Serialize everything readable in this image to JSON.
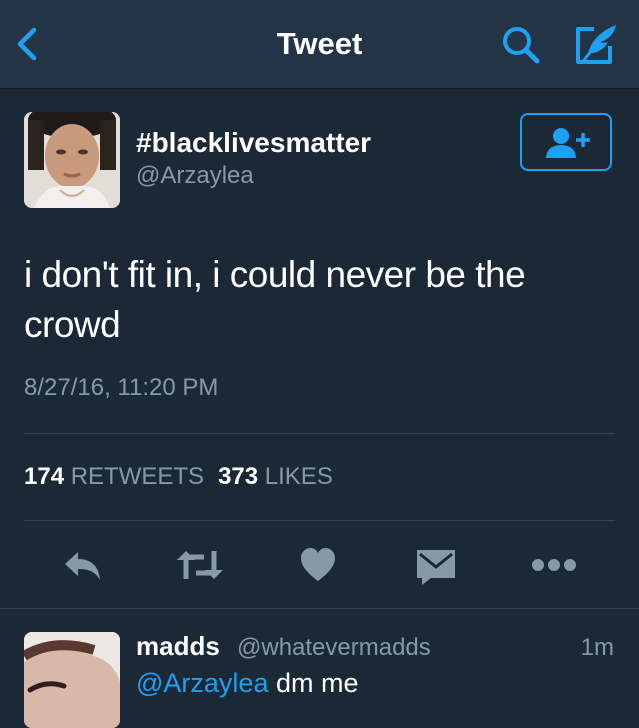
{
  "nav": {
    "title": "Tweet",
    "back_icon": "chevron-left-icon",
    "search_icon": "search-icon",
    "compose_icon": "compose-tweet-icon",
    "accent": "#1da1f2"
  },
  "tweet": {
    "display_name": "#blacklivesmatter",
    "handle": "@Arzaylea",
    "follow_icon": "follow-user-icon",
    "text": "i don't fit in, i could never be the crowd",
    "timestamp": "8/27/16, 11:20 PM",
    "retweets_count": "174",
    "retweets_label": "RETWEETS",
    "likes_count": "373",
    "likes_label": "LIKES"
  },
  "actions": [
    {
      "icon": "reply-icon"
    },
    {
      "icon": "retweet-icon"
    },
    {
      "icon": "heart-icon"
    },
    {
      "icon": "direct-message-icon"
    },
    {
      "icon": "more-icon"
    }
  ],
  "reply": {
    "display_name": "madds",
    "handle": "@whatevermadds",
    "time": "1m",
    "mention": "@Arzaylea",
    "text": "dm me"
  },
  "colors": {
    "background": "#1b2836",
    "navbar": "#243447",
    "secondary_text": "#8899a6",
    "icon_gray": "#8899a6",
    "divider": "#38444d"
  }
}
